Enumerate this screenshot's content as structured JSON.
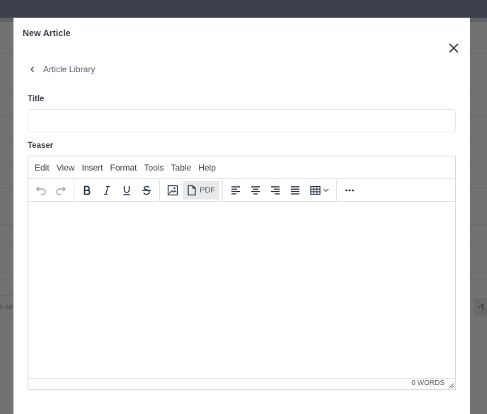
{
  "background": {
    "left_text": "s-se",
    "right_button_text": "›¶"
  },
  "modal": {
    "title": "New Article",
    "close_icon": "close-icon",
    "breadcrumb": {
      "icon": "chevron-left-icon",
      "label": "Article Library"
    },
    "fields": {
      "title": {
        "label": "Title",
        "value": "",
        "placeholder": ""
      },
      "teaser": {
        "label": "Teaser"
      }
    },
    "editor": {
      "menu": [
        {
          "label": "Edit"
        },
        {
          "label": "View"
        },
        {
          "label": "Insert"
        },
        {
          "label": "Format"
        },
        {
          "label": "Tools"
        },
        {
          "label": "Table"
        },
        {
          "label": "Help"
        }
      ],
      "toolbar": {
        "undo": "undo-icon",
        "redo": "redo-icon",
        "bold": "bold-icon",
        "italic": "italic-icon",
        "underline": "underline-icon",
        "strikethrough": "strikethrough-icon",
        "image": "image-icon",
        "pdf_label": "PDF",
        "align_left": "align-left-icon",
        "align_center": "align-center-icon",
        "align_right": "align-right-icon",
        "justify": "justify-icon",
        "table": "table-icon",
        "more": "more-icon"
      },
      "word_count": "0 WORDS"
    }
  }
}
